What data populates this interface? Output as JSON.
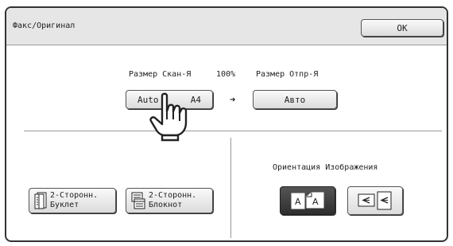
{
  "window": {
    "title": "Факс/Оригинал"
  },
  "toolbar": {
    "ok_label": "OK"
  },
  "size": {
    "scan_label": "Размер Скан-Я",
    "ratio": "100%",
    "send_label": "Размер Отпр-Я",
    "scan_value_a": "Auto",
    "scan_value_b": "A4",
    "send_value": "Авто",
    "arrow": "➜"
  },
  "duplex": {
    "book_label_line1": "2-Сторонн.",
    "book_label_line2": "Буклет",
    "pad_label_line1": "2-Сторонн.",
    "pad_label_line2": "Блокнот"
  },
  "orientation": {
    "label": "Ориентация Изображения",
    "selected": "portrait",
    "portrait_icon": "portrait-a-pages-icon",
    "landscape_icon": "landscape-a-pages-icon"
  },
  "colors": {
    "selected_bg": "#333333",
    "panel_border": "#333333",
    "title_bg": "#e6e6e6"
  },
  "cursor": {
    "icon": "pointing-hand-icon"
  }
}
